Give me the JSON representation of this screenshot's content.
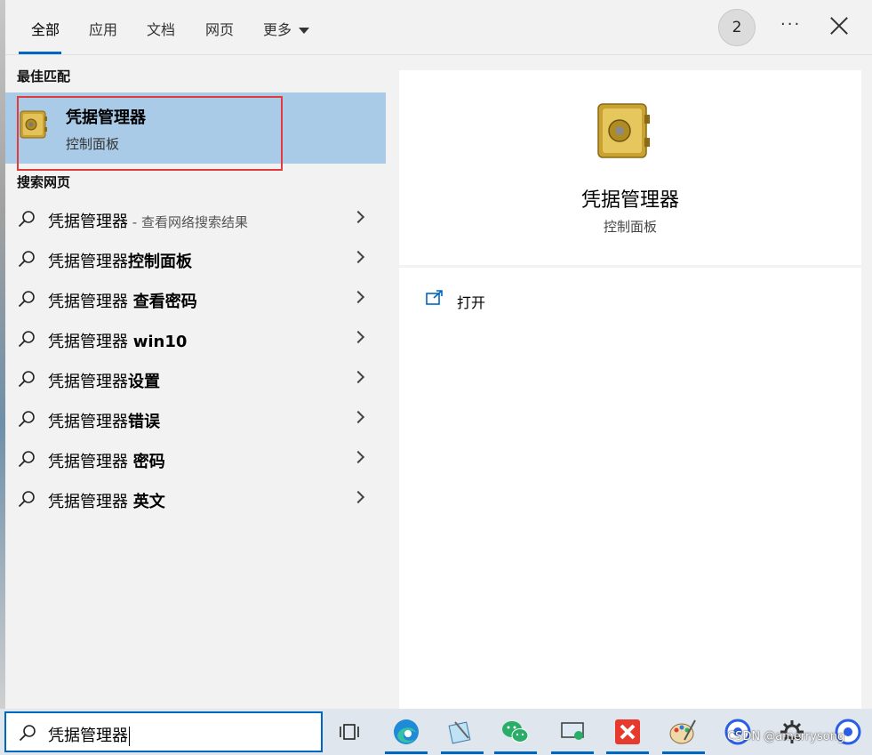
{
  "tabs": [
    {
      "label": "全部",
      "active": true
    },
    {
      "label": "应用"
    },
    {
      "label": "文档"
    },
    {
      "label": "网页"
    },
    {
      "label": "更多"
    }
  ],
  "header": {
    "badge_count": "2",
    "more_label": "···"
  },
  "best_match": {
    "section_label": "最佳匹配",
    "title": "凭据管理器",
    "subtitle": "控制面板"
  },
  "web_search": {
    "section_label": "搜索网页",
    "items": [
      {
        "prefix": "凭据管理器",
        "bold": "",
        "dim": " - 查看网络搜索结果"
      },
      {
        "prefix": "凭据管理器",
        "bold": "控制面板",
        "dim": ""
      },
      {
        "prefix": "凭据管理器 ",
        "bold": "查看密码",
        "dim": ""
      },
      {
        "prefix": "凭据管理器 ",
        "bold": "win10",
        "dim": ""
      },
      {
        "prefix": "凭据管理器",
        "bold": "设置",
        "dim": ""
      },
      {
        "prefix": "凭据管理器",
        "bold": "错误",
        "dim": ""
      },
      {
        "prefix": "凭据管理器 ",
        "bold": "密码",
        "dim": ""
      },
      {
        "prefix": "凭据管理器 ",
        "bold": "英文",
        "dim": ""
      }
    ]
  },
  "preview": {
    "title": "凭据管理器",
    "subtitle": "控制面板",
    "actions": [
      {
        "label": "打开",
        "icon": "open-window-icon"
      }
    ]
  },
  "search": {
    "value": "凭据管理器"
  },
  "taskbar": {
    "icons": [
      "task-view-icon",
      "edge-icon",
      "notepad-icon",
      "wechat-icon",
      "remote-desktop-icon",
      "xmind-icon",
      "paint-icon",
      "baidu-netdisk-icon",
      "settings-icon",
      "baidu-netdisk-icon-2"
    ],
    "watermark": "CSDN @amerrysong"
  },
  "colors": {
    "accent": "#0067c0",
    "selected": "#a9cbe7",
    "highlight_box": "#e23b3b"
  }
}
